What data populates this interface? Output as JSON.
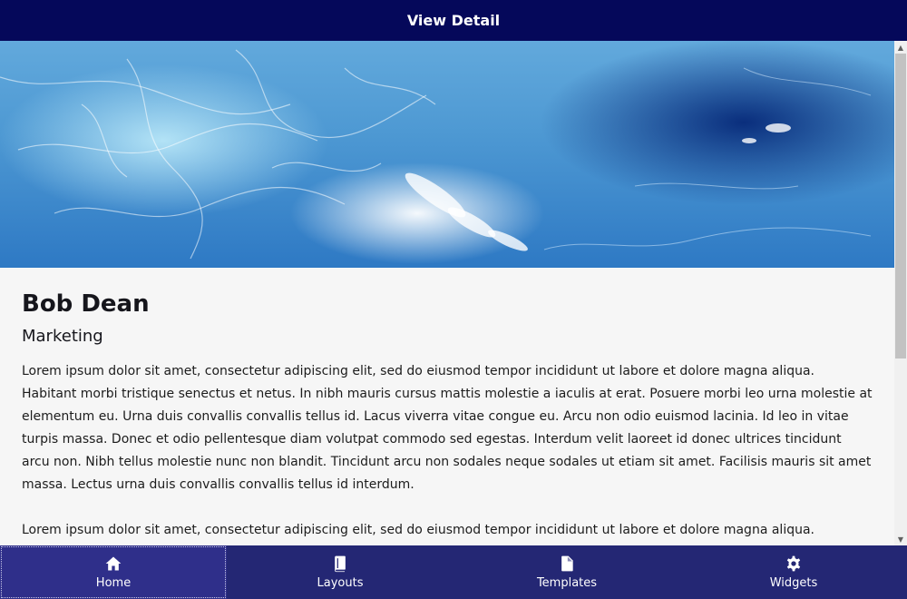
{
  "header": {
    "title": "View Detail"
  },
  "hero": {
    "image": "ocean-water-banner"
  },
  "profile": {
    "name": "Bob Dean",
    "department": "Marketing",
    "paragraphs": [
      "Lorem ipsum dolor sit amet, consectetur adipiscing elit, sed do eiusmod tempor incididunt ut labore et dolore magna aliqua. Habitant morbi tristique senectus et netus. In nibh mauris cursus mattis molestie a iaculis at erat. Posuere morbi leo urna molestie at elementum eu. Urna duis convallis convallis tellus id. Lacus viverra vitae congue eu. Arcu non odio euismod lacinia. Id leo in vitae turpis massa. Donec et odio pellentesque diam volutpat commodo sed egestas. Interdum velit laoreet id donec ultrices tincidunt arcu non. Nibh tellus molestie nunc non blandit. Tincidunt arcu non sodales neque sodales ut etiam sit amet. Facilisis mauris sit amet massa. Lectus urna duis convallis convallis tellus id interdum.",
      "Lorem ipsum dolor sit amet, consectetur adipiscing elit, sed do eiusmod tempor incididunt ut labore et dolore magna aliqua. Habitant"
    ]
  },
  "nav": {
    "items": [
      {
        "label": "Home",
        "icon": "home-icon"
      },
      {
        "label": "Layouts",
        "icon": "book-icon"
      },
      {
        "label": "Templates",
        "icon": "document-icon"
      },
      {
        "label": "Widgets",
        "icon": "gear-icon"
      }
    ],
    "active": "Home"
  },
  "colors": {
    "header_bg": "#05085a",
    "nav_bg": "#242774",
    "nav_active_bg": "#2f2f8a",
    "content_bg": "#f6f6f6"
  }
}
